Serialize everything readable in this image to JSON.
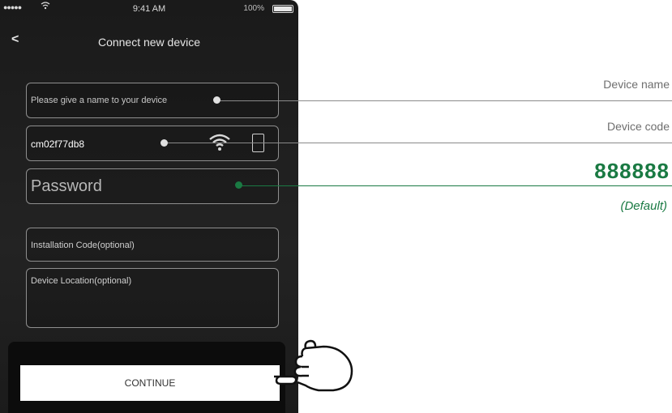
{
  "status_bar": {
    "signal": "●●●●●",
    "time": "9:41 AM",
    "battery_percent": "100%"
  },
  "nav": {
    "back_icon": "chevron-left-icon",
    "title": "Connect new device"
  },
  "form": {
    "device_name_placeholder": "Please give a name to your device",
    "device_code_value": "cm02f77db8",
    "password_placeholder": "Password",
    "installation_code_placeholder": "Installation Code(optional)",
    "device_location_placeholder": "Device Location(optional)"
  },
  "continue_label": "CONTINUE",
  "callouts": {
    "device_name": "Device name",
    "device_code": "Device code",
    "password_default": "888888",
    "default_note": "(Default)"
  },
  "colors": {
    "accent_green": "#1a7a43",
    "callout_gray": "#8a8a8a"
  }
}
